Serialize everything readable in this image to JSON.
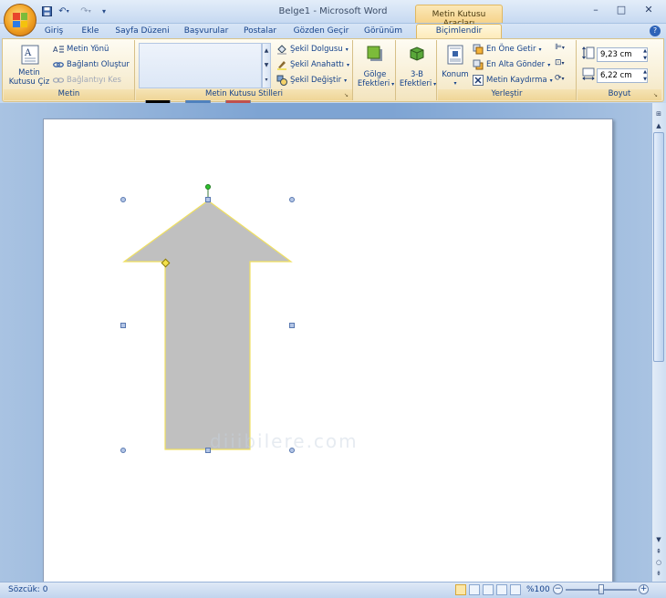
{
  "window": {
    "title": "Belge1 - Microsoft Word",
    "context_tool_title": "Metin Kutusu Araçları",
    "minimize": "–",
    "maximize": "□",
    "close": "✕"
  },
  "qat": {
    "save_icon": "save-icon",
    "undo_icon": "undo-icon",
    "redo_icon": "redo-icon"
  },
  "tabs": [
    {
      "label": "Giriş"
    },
    {
      "label": "Ekle"
    },
    {
      "label": "Sayfa Düzeni"
    },
    {
      "label": "Başvurular"
    },
    {
      "label": "Postalar"
    },
    {
      "label": "Gözden Geçir"
    },
    {
      "label": "Görünüm"
    },
    {
      "label": "Biçimlendir"
    }
  ],
  "ribbon": {
    "metin": {
      "label": "Metin",
      "draw_line1": "Metin",
      "draw_line2": "Kutusu Çiz",
      "direction": "Metin Yönü",
      "create_link": "Bağlantı Oluştur",
      "break_link": "Bağlantıyı Kes"
    },
    "styles": {
      "label": "Metin Kutusu Stilleri",
      "swatches": [
        "#000000",
        "#4f81bd",
        "#c0504d"
      ],
      "fill": "Şekil Dolgusu",
      "outline": "Şekil Anahattı",
      "change": "Şekil Değiştir"
    },
    "shadow": {
      "line1": "Gölge",
      "line2": "Efektleri"
    },
    "threed": {
      "line1": "3-B",
      "line2": "Efektleri"
    },
    "arrange": {
      "label": "Yerleştir",
      "position": "Konum",
      "bring_front": "En Öne Getir",
      "send_back": "En Alta Gönder",
      "wrap": "Metin Kaydırma"
    },
    "size": {
      "label": "Boyut",
      "height": "9,23 cm",
      "width": "6,22 cm"
    }
  },
  "document": {
    "watermark": "diiibilere.com",
    "shape_fill": "#c0c0c0",
    "shape_outline": "#f0e060"
  },
  "status": {
    "word_count": "Sözcük: 0",
    "zoom": "%100",
    "zoom_fraction": 0.5
  }
}
